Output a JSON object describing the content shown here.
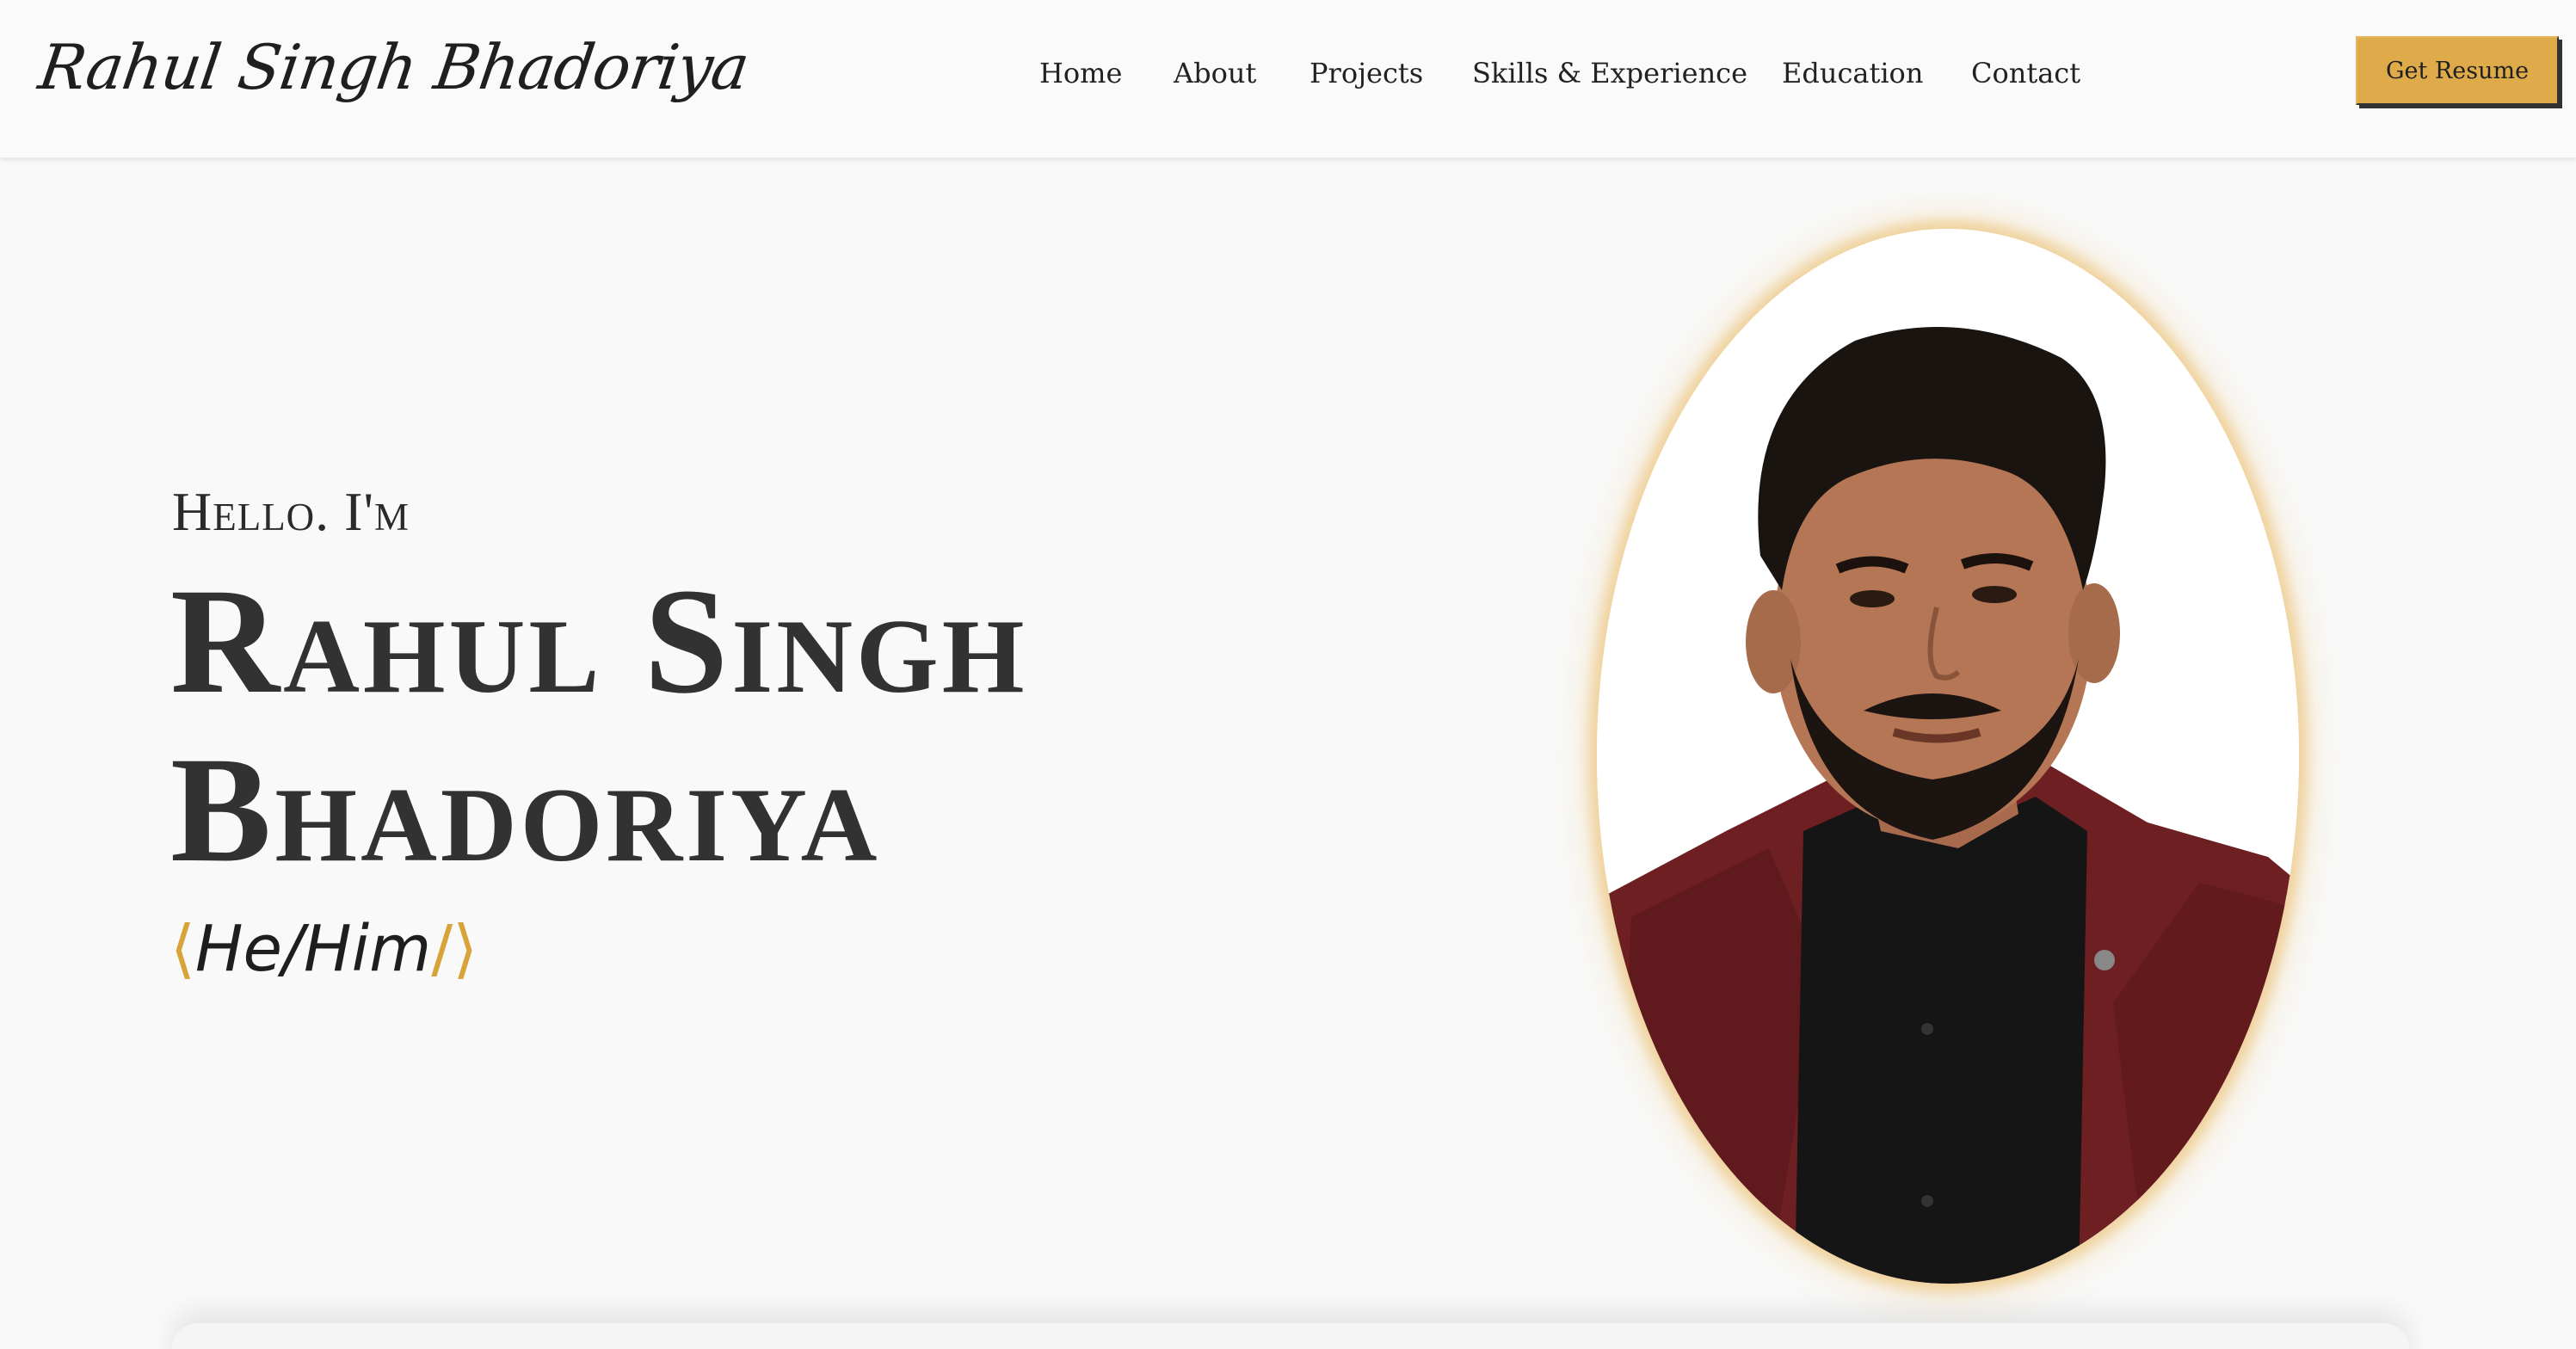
{
  "header": {
    "logo": "Rahul Singh Bhadoriya",
    "nav": [
      "Home",
      "About",
      "Projects",
      "Skills & Experience",
      "Education",
      "Contact"
    ],
    "resume_button": "Get Resume"
  },
  "hero": {
    "greeting": "Hello. I'm",
    "name_line1": "Rahul Singh",
    "name_line2": "Bhadoriya",
    "pronoun_open": "⟨",
    "pronoun": "He/Him",
    "pronoun_close": "/⟩"
  },
  "colors": {
    "accent": "#deaa4a",
    "text": "#2b2b2b",
    "background": "#f9f9f9"
  }
}
